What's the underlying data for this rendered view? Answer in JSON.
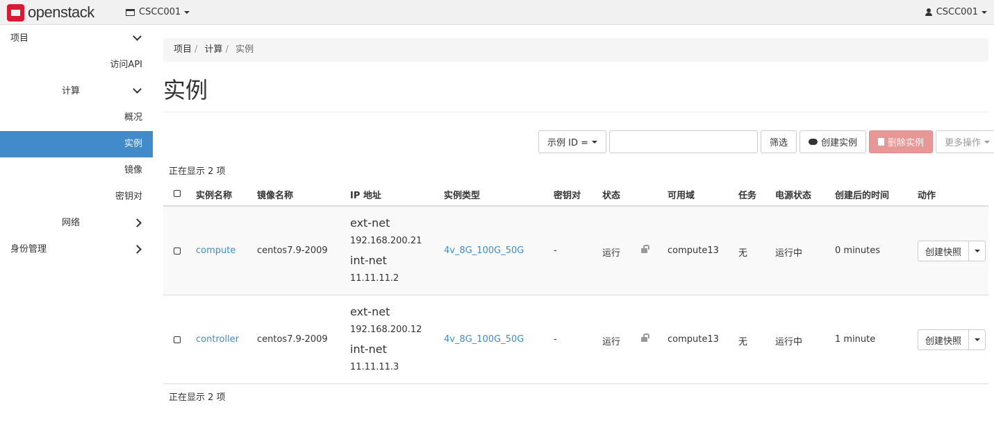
{
  "header": {
    "logo_text": "openstack",
    "project": "CSCC001",
    "user": "CSCC001"
  },
  "sidebar": {
    "items": [
      {
        "label": "项目",
        "level": 0,
        "chevron": "down"
      },
      {
        "label": "访问API",
        "level": 2
      },
      {
        "label": "计算",
        "level": 1,
        "chevron": "down"
      },
      {
        "label": "概况",
        "level": 2
      },
      {
        "label": "实例",
        "level": 2,
        "active": true
      },
      {
        "label": "镜像",
        "level": 2
      },
      {
        "label": "密钥对",
        "level": 2
      },
      {
        "label": "网络",
        "level": 1,
        "chevron": "right"
      },
      {
        "label": "身份管理",
        "level": 0,
        "chevron": "right"
      }
    ]
  },
  "breadcrumb": [
    "项目",
    "计算",
    "实例"
  ],
  "page_title": "实例",
  "toolbar": {
    "filter_field": "示例 ID =",
    "filter_value": "",
    "filter_button": "筛选",
    "create_button": "创建实例",
    "delete_button": "删除实例",
    "more_button": "更多操作"
  },
  "count_text": "正在显示 2 项",
  "table": {
    "columns": [
      "实例名称",
      "镜像名称",
      "IP 地址",
      "实例类型",
      "密钥对",
      "状态",
      "可用域",
      "任务",
      "电源状态",
      "创建后的时间",
      "动作"
    ],
    "rows": [
      {
        "name": "compute",
        "image": "centos7.9-2009",
        "net1": "ext-net",
        "ip1": "192.168.200.21",
        "net2": "int-net",
        "ip2": "11.11.11.2",
        "flavor": "4v_8G_100G_50G",
        "keypair": "-",
        "status": "运行",
        "zone": "compute13",
        "task": "无",
        "power": "运行中",
        "age": "0 minutes",
        "action": "创建快照"
      },
      {
        "name": "controller",
        "image": "centos7.9-2009",
        "net1": "ext-net",
        "ip1": "192.168.200.12",
        "net2": "int-net",
        "ip2": "11.11.11.3",
        "flavor": "4v_8G_100G_50G",
        "keypair": "-",
        "status": "运行",
        "zone": "compute13",
        "task": "无",
        "power": "运行中",
        "age": "1 minute",
        "action": "创建快照"
      }
    ]
  },
  "colors": {
    "accent": "#428bca",
    "danger": "#e79796",
    "brand": "#da1a32"
  }
}
